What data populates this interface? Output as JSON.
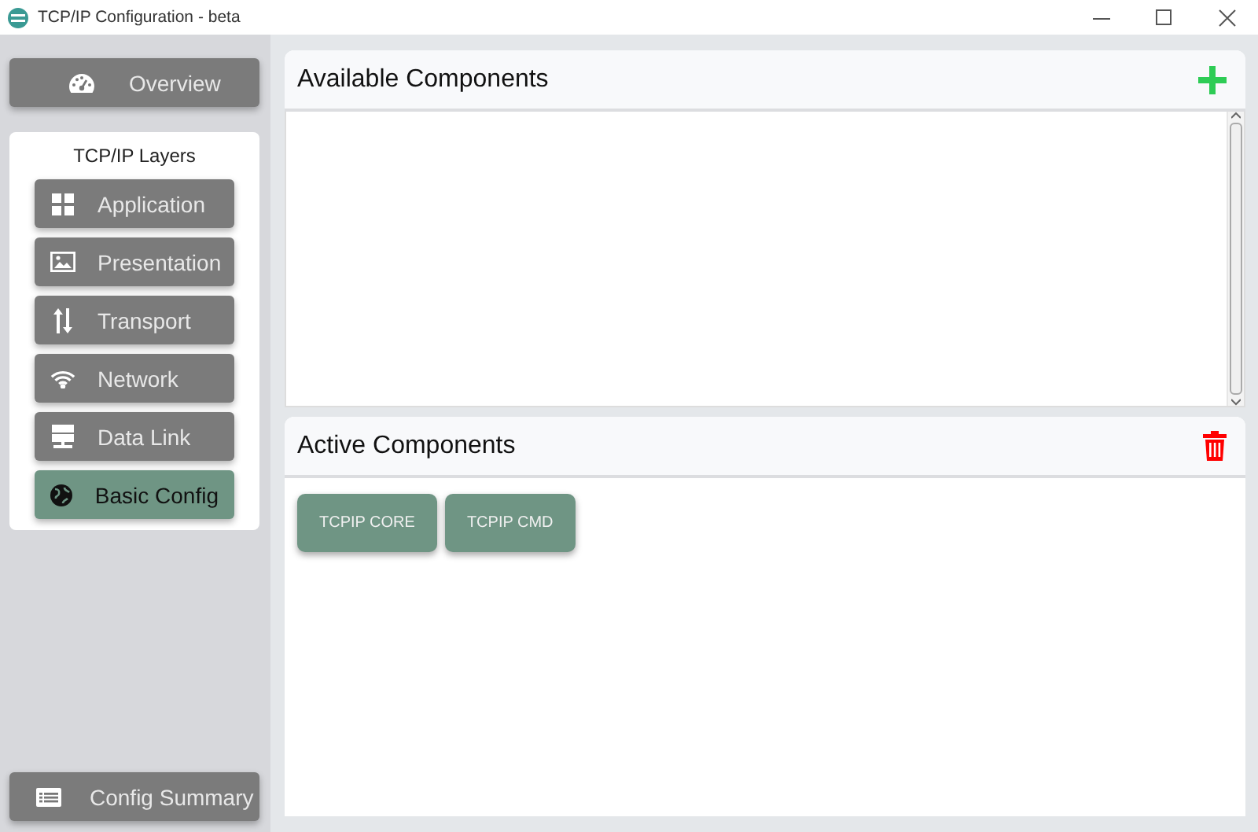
{
  "window": {
    "title": "TCP/IP Configuration - beta"
  },
  "sidebar": {
    "overview": "Overview",
    "layers_title": "TCP/IP Layers",
    "layers": [
      {
        "label": "Application",
        "selected": false
      },
      {
        "label": "Presentation",
        "selected": false
      },
      {
        "label": "Transport",
        "selected": false
      },
      {
        "label": "Network",
        "selected": false
      },
      {
        "label": "Data Link",
        "selected": false
      },
      {
        "label": "Basic Config",
        "selected": true
      }
    ],
    "summary": "Config Summary"
  },
  "available": {
    "title": "Available Components"
  },
  "active": {
    "title": "Active Components",
    "components": [
      {
        "label": "TCPIP CORE"
      },
      {
        "label": "TCPIP CMD"
      }
    ]
  }
}
